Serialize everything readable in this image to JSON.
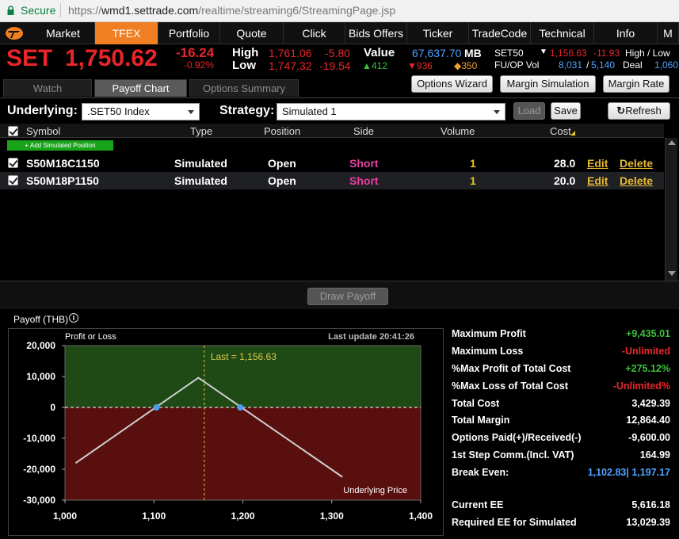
{
  "browser": {
    "secure_label": "Secure",
    "url_scheme": "https://",
    "url_host": "wmd1.settrade.com",
    "url_path": "/realtime/streaming6/StreamingPage.jsp"
  },
  "nav": {
    "items": [
      "Market",
      "TFEX",
      "Portfolio",
      "Quote",
      "Click",
      "Bids Offers",
      "Ticker",
      "TradeCode",
      "Technical",
      "Info",
      "M"
    ],
    "active": "TFEX"
  },
  "quote": {
    "symbol": "SET",
    "last": "1,750.62",
    "change": "-16.24",
    "pct": "-0.92%",
    "high_label": "High",
    "high": "1,761.06",
    "high_chg": "-5.80",
    "low_label": "Low",
    "low": "1,747.32",
    "low_chg": "-19.54",
    "value_label": "Value",
    "value": "67,637.70",
    "value_unit": "MB",
    "up": "412",
    "down": "936",
    "unchanged": "350",
    "set50_label": "SET50",
    "set50": "1,156.63",
    "set50_chg": "-11.93",
    "hl_label": "High / Low",
    "fuop_label": "FU/OP Vol",
    "fuop_a": "8,031",
    "fuop_b": "5,140",
    "deal_label": "Deal",
    "deal": "1,060"
  },
  "tabs": {
    "watch": "Watch",
    "payoff": "Payoff Chart",
    "options_summary": "Options Summary"
  },
  "toolbar": {
    "options_wizard": "Options Wizard",
    "margin_simulation": "Margin Simulation",
    "margin_rate": "Margin Rate"
  },
  "controls": {
    "underlying_label": "Underlying:",
    "underlying_value": ".SET50 Index",
    "strategy_label": "Strategy:",
    "strategy_value": "Simulated 1",
    "load": "Load",
    "save": "Save",
    "refresh": "Refresh"
  },
  "grid": {
    "headers": {
      "symbol": "Symbol",
      "type": "Type",
      "position": "Position",
      "side": "Side",
      "volume": "Volume",
      "cost": "Cost"
    },
    "add_button": "+ Add Simulated Position",
    "rows": [
      {
        "symbol": "S50M18C1150",
        "type": "Simulated",
        "position": "Open",
        "side": "Short",
        "volume": "1",
        "cost": "28.0",
        "edit": "Edit",
        "delete": "Delete"
      },
      {
        "symbol": "S50M18P1150",
        "type": "Simulated",
        "position": "Open",
        "side": "Short",
        "volume": "1",
        "cost": "20.0",
        "edit": "Edit",
        "delete": "Delete"
      }
    ]
  },
  "draw_payoff": "Draw Payoff",
  "payoff_title": "Payoff (THB)",
  "chart_data": {
    "type": "line",
    "title": "",
    "ylabel": "Profit or Loss",
    "xlabel": "Underlying Price",
    "last_update": "Last update 20:41:26",
    "last_label": "Last = 1,156.63",
    "last_x": 1156.63,
    "xlim": [
      1000,
      1400
    ],
    "ylim": [
      -30000,
      20000
    ],
    "x_ticks": [
      "1,000",
      "1,100",
      "1,200",
      "1,300",
      "1,400"
    ],
    "y_ticks": [
      "20,000",
      "10,000",
      "0",
      "-10,000",
      "-20,000",
      "-30,000"
    ],
    "series": [
      {
        "x": [
          1012,
          1150,
          1312
        ],
        "y": [
          -18000,
          9600,
          -22500
        ]
      }
    ],
    "breakeven_points": [
      [
        1102.83,
        0
      ],
      [
        1197.17,
        0
      ]
    ],
    "colors": {
      "profit_bg": "#1f4a16",
      "loss_bg": "#5a0f0f",
      "line": "#cfcfcf",
      "marker": "#4a9ef0",
      "last_line": "#d8c84a"
    }
  },
  "summary": [
    {
      "label": "Maximum Profit",
      "value": "+9,435.01",
      "color": "#3bc23b"
    },
    {
      "label": "Maximum Loss",
      "value": "-Unlimited",
      "color": "#e8262a"
    },
    {
      "label": "%Max Profit of Total Cost",
      "value": "+275.12%",
      "color": "#3bc23b"
    },
    {
      "label": "%Max Loss of Total Cost",
      "value": "-Unlimited%",
      "color": "#e8262a"
    },
    {
      "label": "Total Cost",
      "value": "3,429.39",
      "color": "#ffffff"
    },
    {
      "label": "Total Margin",
      "value": "12,864.40",
      "color": "#ffffff"
    },
    {
      "label": "Options Paid(+)/Received(-)",
      "value": "-9,600.00",
      "color": "#ffffff"
    },
    {
      "label": "1st Step Comm.(Incl. VAT)",
      "value": "164.99",
      "color": "#ffffff"
    },
    {
      "label": "Break Even:",
      "value": "1,102.83| 1,197.17",
      "color": "#4fa3ff"
    },
    {
      "label": "Current EE",
      "value": "5,616.18",
      "color": "#ffffff"
    },
    {
      "label": "Required EE for Simulated",
      "value": "13,029.39",
      "color": "#ffffff"
    }
  ]
}
